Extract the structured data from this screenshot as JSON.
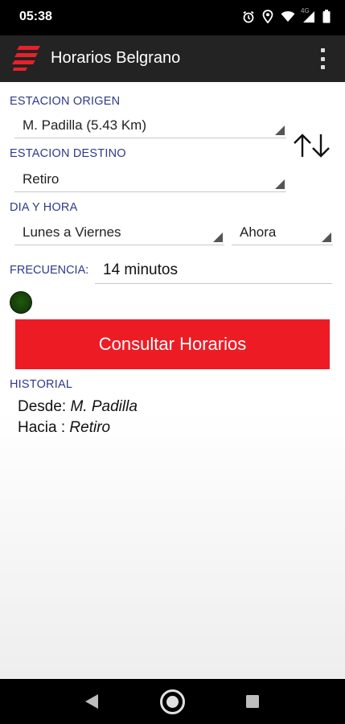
{
  "status_bar": {
    "time": "05:38",
    "network": "4G",
    "icons": [
      "alarm-icon",
      "location-icon",
      "wifi-icon",
      "signal-icon",
      "battery-icon"
    ]
  },
  "app_bar": {
    "title": "Horarios Belgrano",
    "logo": "train-logo-icon",
    "menu": "overflow-menu-icon"
  },
  "origin": {
    "label": "ESTACION ORIGEN",
    "value": "M. Padilla (5.43 Km)"
  },
  "destination": {
    "label": "ESTACION DESTINO",
    "value": "Retiro"
  },
  "swap": {
    "icon": "swap-arrows-icon"
  },
  "day_time": {
    "label": "DIA Y HORA",
    "day_value": "Lunes a Viernes",
    "time_value": "Ahora"
  },
  "frequency": {
    "label": "FRECUENCIA:",
    "value": "14 minutos"
  },
  "consult_button": {
    "label": "Consultar Horarios"
  },
  "history": {
    "label": "HISTORIAL",
    "from_prefix": "Desde:",
    "from_value": "M. Padilla",
    "to_prefix": "Hacia :",
    "to_value": "Retiro"
  },
  "nav_bar": {
    "icons": [
      "back-icon",
      "home-icon",
      "recents-icon"
    ]
  },
  "colors": {
    "accent_red": "#ed1c24",
    "label_blue": "#2e3a8a",
    "app_bar": "#232323",
    "indicator_green": "#1e5a0e"
  }
}
